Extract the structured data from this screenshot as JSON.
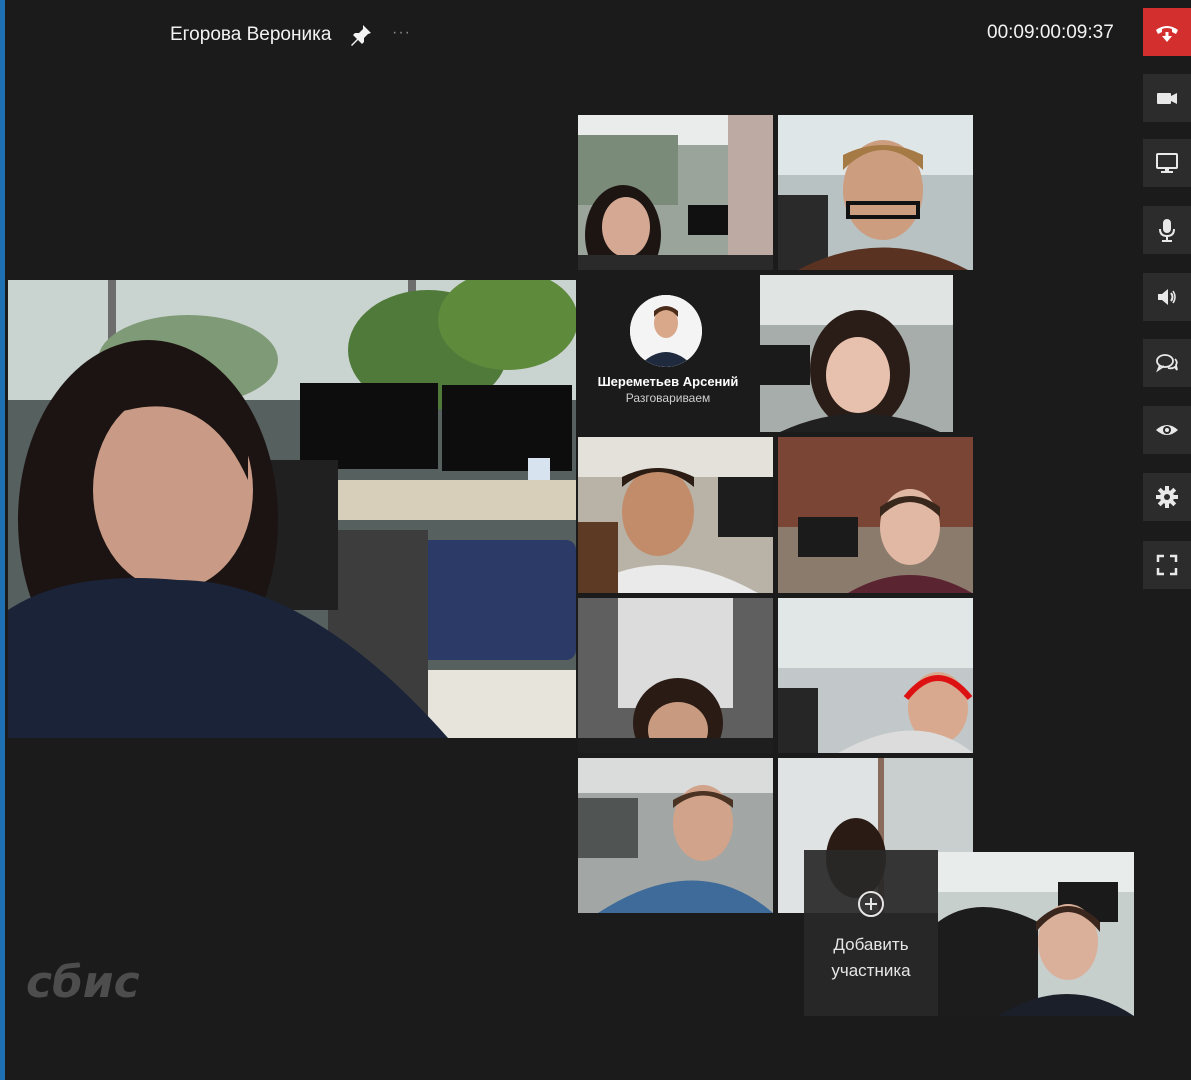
{
  "header": {
    "caller_name": "Егорова Вероника",
    "menu_dots": "···",
    "timer": "00:09:00:09:37"
  },
  "toolbar": {
    "buttons": [
      {
        "name": "hang-up",
        "icon": "hangup-icon",
        "color": "#d32f2f"
      },
      {
        "name": "camera",
        "icon": "camera-icon"
      },
      {
        "name": "screen-share",
        "icon": "monitor-icon"
      },
      {
        "name": "microphone",
        "icon": "microphone-icon"
      },
      {
        "name": "speaker",
        "icon": "speaker-icon"
      },
      {
        "name": "chat",
        "icon": "chat-icon"
      },
      {
        "name": "view",
        "icon": "eye-icon"
      },
      {
        "name": "settings",
        "icon": "gear-icon"
      },
      {
        "name": "fullscreen",
        "icon": "fullscreen-icon"
      }
    ]
  },
  "participants": {
    "avatar_tile": {
      "name": "Шереметьев Арсений",
      "status": "Разговариваем"
    }
  },
  "add_participant": {
    "line1": "Добавить",
    "line2": "участника"
  },
  "brand": {
    "logo_text": "сбис",
    "accent": "#d32f2f",
    "edge": "#1f6fb3"
  }
}
